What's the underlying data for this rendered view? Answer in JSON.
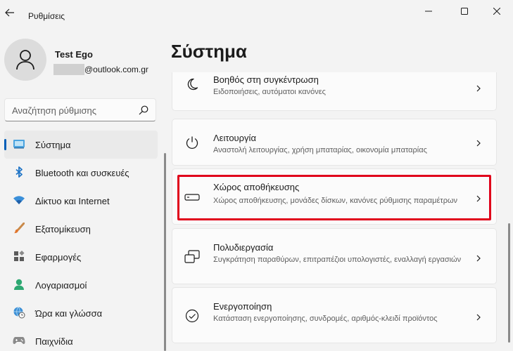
{
  "window": {
    "title": "Ρυθμίσεις"
  },
  "profile": {
    "name": "Test Ego",
    "email_suffix": "@outlook.com.gr"
  },
  "search": {
    "placeholder": "Αναζήτηση ρύθμισης"
  },
  "sidebar": {
    "items": [
      {
        "label": "Σύστημα",
        "icon": "system-icon",
        "active": true
      },
      {
        "label": "Bluetooth και συσκευές",
        "icon": "bluetooth-icon"
      },
      {
        "label": "Δίκτυο και Internet",
        "icon": "wifi-icon"
      },
      {
        "label": "Εξατομίκευση",
        "icon": "brush-icon"
      },
      {
        "label": "Εφαρμογές",
        "icon": "apps-icon"
      },
      {
        "label": "Λογαριασμοί",
        "icon": "account-icon"
      },
      {
        "label": "Ώρα και γλώσσα",
        "icon": "globe-clock-icon"
      },
      {
        "label": "Παιχνίδια",
        "icon": "gamepad-icon"
      }
    ]
  },
  "main": {
    "title": "Σύστημα",
    "cards": [
      {
        "title": "Βοηθός στη συγκέντρωση",
        "desc": "Ειδοποιήσεις, αυτόματοι κανόνες",
        "icon": "moon-icon"
      },
      {
        "title": "Λειτουργία",
        "desc": "Αναστολή λειτουργίας, χρήση μπαταρίας, οικονομία μπαταρίας",
        "icon": "power-icon"
      },
      {
        "title": "Χώρος αποθήκευσης",
        "desc": "Χώρος αποθήκευσης, μονάδες δίσκων, κανόνες ρύθμισης παραμέτρων",
        "icon": "storage-icon",
        "highlighted": true
      },
      {
        "title": "Πολυδιεργασία",
        "desc": "Συγκράτηση παραθύρων, επιτραπέζιοι υπολογιστές, εναλλαγή εργασιών",
        "icon": "multitask-icon"
      },
      {
        "title": "Ενεργοποίηση",
        "desc": "Κατάσταση ενεργοποίησης, συνδρομές, αριθμός-κλειδί προϊόντος",
        "icon": "activation-check-icon"
      }
    ]
  },
  "colors": {
    "accent": "#005fb8",
    "highlight": "#e0001b",
    "background": "#f3f3f3",
    "card": "#fbfbfb"
  }
}
